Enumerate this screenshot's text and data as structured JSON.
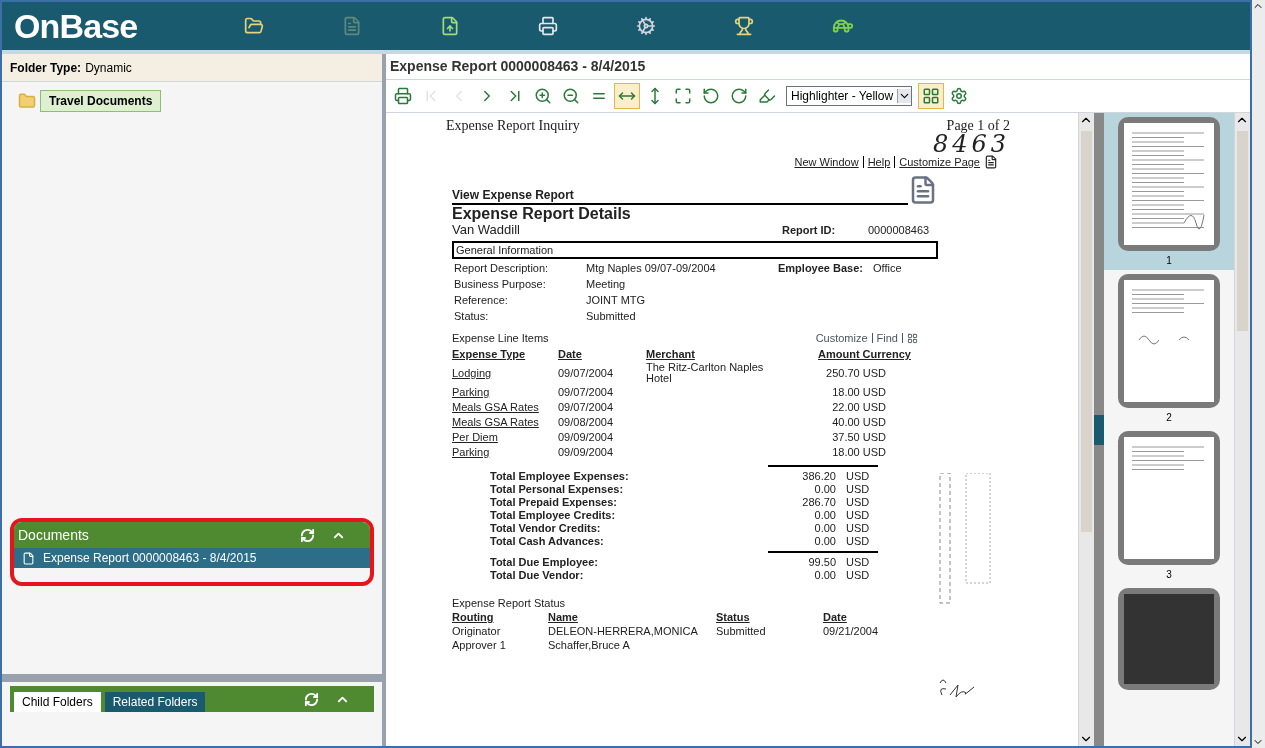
{
  "app": {
    "logo": "OnBase"
  },
  "folder_panel": {
    "folder_type_label": "Folder Type:",
    "folder_type": "Dynamic",
    "tree": [
      {
        "label": "Travel Documents",
        "selected": true
      }
    ]
  },
  "documents_panel": {
    "title": "Documents",
    "items": [
      {
        "label": "Expense Report 0000008463 - 8/4/2015",
        "selected": true
      }
    ]
  },
  "folders_panel": {
    "tabs": [
      {
        "label": "Child Folders",
        "selected": true
      },
      {
        "label": "Related Folders",
        "selected": false
      }
    ]
  },
  "viewer": {
    "title": "Expense Report 0000008463 - 8/4/2015",
    "highlighter": "Highlighter - Yellow",
    "toolbar": [
      {
        "kind": "print",
        "selected": false,
        "disabled": false
      },
      {
        "kind": "first",
        "selected": false,
        "disabled": true
      },
      {
        "kind": "prev",
        "selected": false,
        "disabled": true
      },
      {
        "kind": "next",
        "selected": false,
        "disabled": false
      },
      {
        "kind": "last",
        "selected": false,
        "disabled": false
      },
      {
        "kind": "zoom-in",
        "selected": false,
        "disabled": false
      },
      {
        "kind": "zoom-out",
        "selected": false,
        "disabled": false
      },
      {
        "kind": "actual",
        "selected": false,
        "disabled": false
      },
      {
        "kind": "fit-width",
        "selected": true,
        "disabled": false
      },
      {
        "kind": "fit-height",
        "selected": false,
        "disabled": false
      },
      {
        "kind": "fit-page",
        "selected": false,
        "disabled": false
      },
      {
        "kind": "rotate-left",
        "selected": false,
        "disabled": false
      },
      {
        "kind": "rotate-right",
        "selected": false,
        "disabled": false
      },
      {
        "kind": "highlight",
        "selected": false,
        "disabled": false
      },
      {
        "kind": "select",
        "selected": false,
        "disabled": false
      },
      {
        "kind": "colors",
        "selected": true,
        "disabled": false
      },
      {
        "kind": "settings",
        "selected": false,
        "disabled": false
      }
    ]
  },
  "document": {
    "inquiry": "Expense Report Inquiry",
    "page": "Page 1 of 2",
    "handwritten": "8463",
    "links": [
      "New Window",
      "Help",
      "Customize Page"
    ],
    "section": "View Expense Report",
    "heading": "Expense Report Details",
    "employee": "Van Waddill",
    "report_id_label": "Report ID:",
    "report_id": "0000008463",
    "general": "General Information",
    "fields": [
      {
        "label": "Report Description:",
        "value": "Mtg Naples 09/07-09/2004"
      },
      {
        "label": "Business Purpose:",
        "value": "Meeting"
      },
      {
        "label": "Reference:",
        "value": "JOINT MTG"
      },
      {
        "label": "Status:",
        "value": "Submitted"
      }
    ],
    "base_label": "Employee Base:",
    "base": "Office",
    "line_items_title": "Expense Line Items",
    "line_tools": [
      "Customize",
      "Find"
    ],
    "columns": [
      "Expense Type",
      "Date",
      "Merchant",
      "Amount Currency"
    ],
    "rows": [
      {
        "type": "Lodging",
        "date": "09/07/2004",
        "merchant": "The Ritz-Carlton Naples Hotel",
        "amount": "250.70 USD"
      },
      {
        "type": "Parking",
        "date": "09/07/2004",
        "merchant": "",
        "amount": "18.00 USD"
      },
      {
        "type": "Meals GSA Rates",
        "date": "09/07/2004",
        "merchant": "",
        "amount": "22.00 USD"
      },
      {
        "type": "Meals GSA Rates",
        "date": "09/08/2004",
        "merchant": "",
        "amount": "40.00 USD"
      },
      {
        "type": "Per Diem",
        "date": "09/09/2004",
        "merchant": "",
        "amount": "37.50 USD"
      },
      {
        "type": "Parking",
        "date": "09/09/2004",
        "merchant": "",
        "amount": "18.00 USD"
      }
    ],
    "totals": [
      {
        "label": "Total Employee Expenses:",
        "amount": "386.20",
        "currency": "USD"
      },
      {
        "label": "Total Personal Expenses:",
        "amount": "0.00",
        "currency": "USD"
      },
      {
        "label": "Total Prepaid Expenses:",
        "amount": "286.70",
        "currency": "USD"
      },
      {
        "label": "Total Employee Credits:",
        "amount": "0.00",
        "currency": "USD"
      },
      {
        "label": "Total Vendor Credits:",
        "amount": "0.00",
        "currency": "USD"
      },
      {
        "label": "Total Cash Advances:",
        "amount": "0.00",
        "currency": "USD"
      }
    ],
    "due": [
      {
        "label": "Total Due Employee:",
        "amount": "99.50",
        "currency": "USD"
      },
      {
        "label": "Total Due Vendor:",
        "amount": "0.00",
        "currency": "USD"
      }
    ],
    "status_title": "Expense Report Status",
    "status_columns": [
      "Routing",
      "Name",
      "Status",
      "Date"
    ],
    "status_rows": [
      {
        "routing": "Originator",
        "name": "DELEON-HERRERA,MONICA",
        "status": "Submitted",
        "date": "09/21/2004"
      },
      {
        "routing": "Approver 1",
        "name": "Schaffer,Bruce A",
        "status": "",
        "date": ""
      }
    ]
  },
  "thumbnails": [
    {
      "label": "1",
      "selected": true
    },
    {
      "label": "2",
      "selected": false
    },
    {
      "label": "3",
      "selected": false
    }
  ]
}
